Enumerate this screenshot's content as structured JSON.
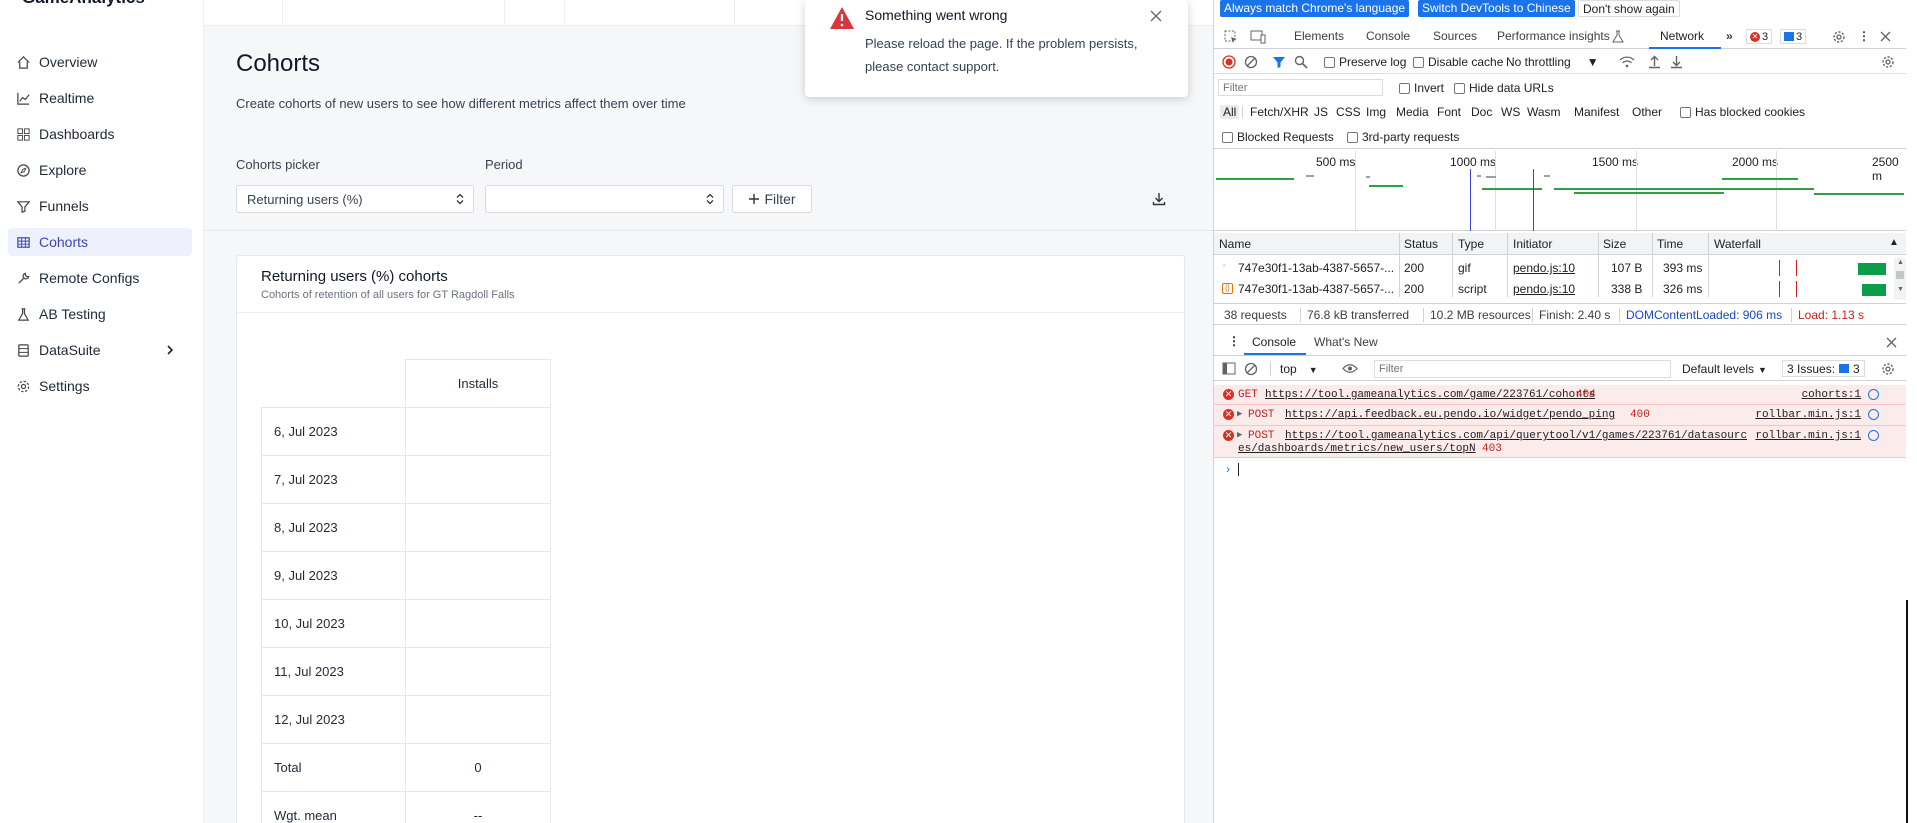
{
  "app": {
    "brand": "GameAnalytics",
    "nav": [
      {
        "label": "Overview",
        "icon": "home-icon"
      },
      {
        "label": "Realtime",
        "icon": "chart-line-icon"
      },
      {
        "label": "Dashboards",
        "icon": "dashboard-grid-icon"
      },
      {
        "label": "Explore",
        "icon": "compass-icon"
      },
      {
        "label": "Funnels",
        "icon": "funnel-icon"
      },
      {
        "label": "Cohorts",
        "icon": "table-icon",
        "active": true
      },
      {
        "label": "Remote Configs",
        "icon": "wrench-icon"
      },
      {
        "label": "AB Testing",
        "icon": "flask-icon"
      },
      {
        "label": "DataSuite",
        "icon": "database-icon"
      },
      {
        "label": "Settings",
        "icon": "gear-icon"
      }
    ],
    "page": {
      "title": "Cohorts",
      "description": "Create cohorts of new users to see how different metrics affect them over time",
      "picker_label": "Cohorts picker",
      "picker_value": "Returning users (%)",
      "period_label": "Period",
      "period_value": "",
      "filter_label": "Filter"
    },
    "card": {
      "title": "Returning users (%) cohorts",
      "subtitle": "Cohorts of retention of all users for GT Ragdoll Falls",
      "column_header": "Installs",
      "rows": [
        {
          "date": "6, Jul 2023",
          "value": ""
        },
        {
          "date": "7, Jul 2023",
          "value": ""
        },
        {
          "date": "8, Jul 2023",
          "value": ""
        },
        {
          "date": "9, Jul 2023",
          "value": ""
        },
        {
          "date": "10, Jul 2023",
          "value": ""
        },
        {
          "date": "11, Jul 2023",
          "value": ""
        },
        {
          "date": "12, Jul 2023",
          "value": ""
        },
        {
          "date": "Total",
          "value": "0"
        },
        {
          "date": "Wgt. mean",
          "value": "--"
        }
      ]
    },
    "toast": {
      "title": "Something went wrong",
      "message": "Please reload the page. If the problem persists, please contact support."
    }
  },
  "devtools": {
    "infobar": {
      "match_language": "Always match Chrome's language",
      "switch_chinese": "Switch DevTools to Chinese",
      "dont_show": "Don't show again"
    },
    "tabs": [
      "Elements",
      "Console",
      "Sources",
      "Performance insights",
      "Network"
    ],
    "active_tab": "Network",
    "error_count": "3",
    "info_count": "3",
    "toolbar": {
      "preserve_log": "Preserve log",
      "disable_cache": "Disable cache",
      "throttling": "No throttling"
    },
    "filter": {
      "placeholder": "Filter",
      "invert": "Invert",
      "hide_data_urls": "Hide data URLs"
    },
    "types": [
      "All",
      "Fetch/XHR",
      "JS",
      "CSS",
      "Img",
      "Media",
      "Font",
      "Doc",
      "WS",
      "Wasm",
      "Manifest",
      "Other"
    ],
    "has_blocked_cookies": "Has blocked cookies",
    "blocked_requests": "Blocked Requests",
    "third_party": "3rd-party requests",
    "timeline_ticks": [
      "500 ms",
      "1000 ms",
      "1500 ms",
      "2000 ms",
      "2500 m"
    ],
    "columns": [
      "Name",
      "Status",
      "Type",
      "Initiator",
      "Size",
      "Time",
      "Waterfall"
    ],
    "requests": [
      {
        "name": "747e30f1-13ab-4387-5657-...",
        "status": "200",
        "type": "gif",
        "initiator": "pendo.js:10",
        "size": "107 B",
        "time": "393 ms"
      },
      {
        "name": "747e30f1-13ab-4387-5657-...",
        "status": "200",
        "type": "script",
        "initiator": "pendo.js:10",
        "size": "338 B",
        "time": "326 ms"
      }
    ],
    "status": {
      "requests": "38 requests",
      "transferred": "76.8 kB transferred",
      "resources": "10.2 MB resources",
      "finish": "Finish: 2.40 s",
      "dcl": "DOMContentLoaded: 906 ms",
      "load": "Load: 1.13 s"
    },
    "drawer_tabs": [
      "Console",
      "What's New"
    ],
    "console": {
      "context": "top",
      "filter_placeholder": "Filter",
      "levels": "Default levels",
      "issues": "3 Issues:",
      "issues_count": "3",
      "messages": [
        {
          "method": "GET",
          "url": "https://tool.gameanalytics.com/game/223761/cohorts",
          "code": "404",
          "source": "cohorts:1"
        },
        {
          "method": "POST",
          "url": "https://api.feedback.eu.pendo.io/widget/pendo_ping",
          "code": "400",
          "source": "rollbar.min.js:1"
        },
        {
          "method": "POST",
          "url": "https://tool.gameanalytics.com/api/querytool/v1/games/223761/datasourc",
          "url2": "es/dashboards/metrics/new_users/topN",
          "code": "403",
          "source": "rollbar.min.js:1"
        }
      ]
    }
  }
}
